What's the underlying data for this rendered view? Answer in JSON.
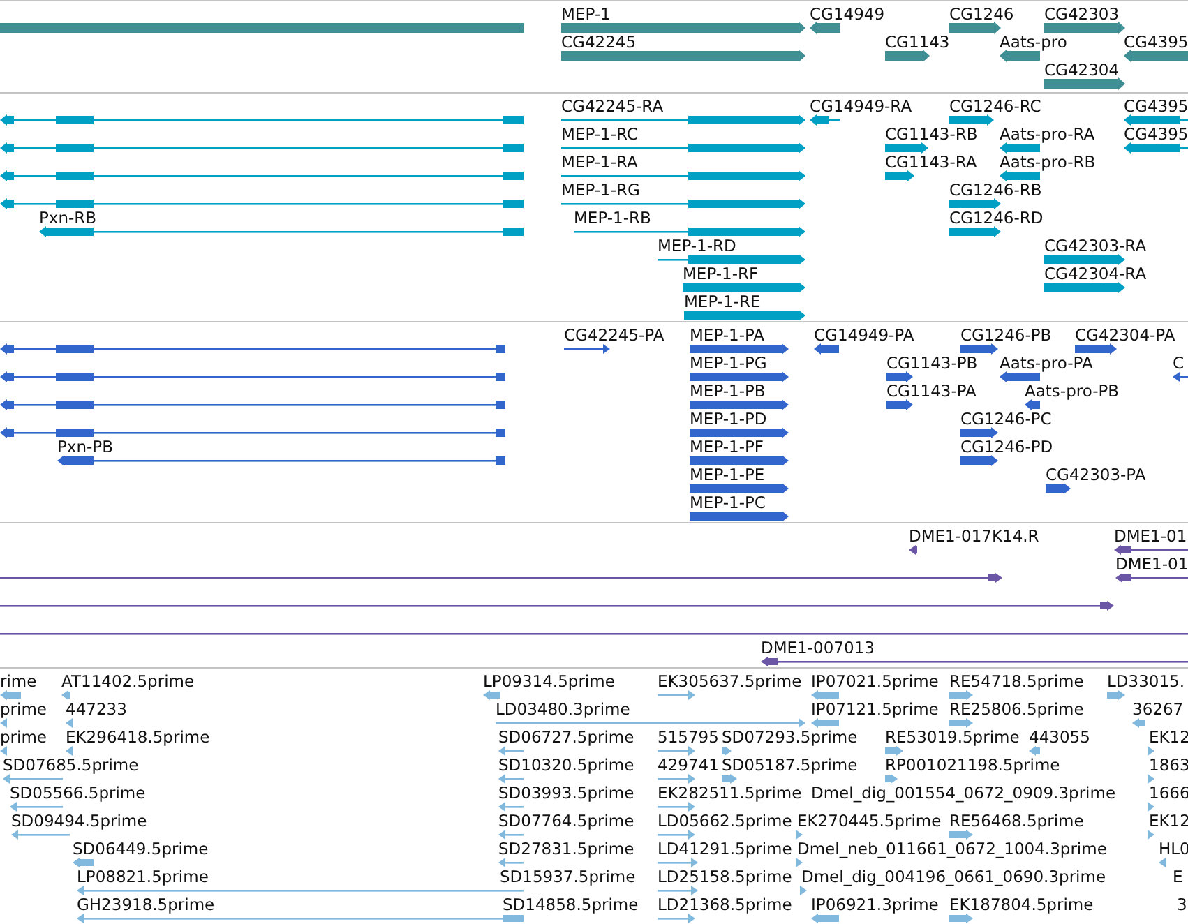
{
  "tracks": [
    {
      "kind": "gene",
      "features": [
        {
          "pointed": false
        },
        {
          "label": "MEP-1",
          "reverse": false
        },
        {
          "label": "CG14949",
          "reverse": true
        },
        {
          "label": "CG1246",
          "reverse": false
        },
        {
          "label": "CG42303",
          "reverse": false
        },
        {
          "label": "CG42245",
          "reverse": false
        },
        {
          "label": "CG1143",
          "reverse": false
        },
        {
          "label": "Aats-pro",
          "reverse": true
        },
        {
          "label": "CG4395",
          "reverse": true
        },
        {
          "label": "CG42304",
          "reverse": false
        }
      ]
    },
    {
      "kind": "transcript",
      "features": [
        {
          "reverse": true
        },
        {
          "label": "CG42245-RA",
          "reverse": false
        },
        {
          "label": "CG14949-RA",
          "reverse": true
        },
        {
          "label": "CG1246-RC",
          "reverse": false
        },
        {
          "label": "CG4395",
          "reverse": true
        },
        {
          "reverse": true
        },
        {
          "label": "MEP-1-RC",
          "reverse": false
        },
        {
          "label": "CG1143-RB",
          "reverse": false
        },
        {
          "label": "Aats-pro-RA",
          "reverse": true
        },
        {
          "label": "CG4395",
          "reverse": true
        },
        {
          "reverse": true
        },
        {
          "label": "MEP-1-RA",
          "reverse": false
        },
        {
          "label": "CG1143-RA",
          "reverse": false
        },
        {
          "label": "Aats-pro-RB",
          "reverse": true
        },
        {
          "reverse": true
        },
        {
          "label": "MEP-1-RG",
          "reverse": false
        },
        {
          "label": "CG1246-RB",
          "reverse": false
        },
        {
          "label": "Pxn-RB",
          "reverse": true
        },
        {
          "label": "MEP-1-RB",
          "reverse": false
        },
        {
          "label": "CG1246-RD",
          "reverse": false
        },
        {
          "label": "MEP-1-RD",
          "reverse": false
        },
        {
          "label": "CG42303-RA",
          "reverse": false
        },
        {
          "label": "MEP-1-RF",
          "reverse": false
        },
        {
          "label": "CG42304-RA",
          "reverse": false
        },
        {
          "label": "MEP-1-RE",
          "reverse": false
        }
      ]
    },
    {
      "kind": "protein",
      "features": [
        {
          "reverse": true
        },
        {
          "label": "CG42245-PA",
          "reverse": false
        },
        {
          "label": "MEP-1-PA",
          "reverse": false
        },
        {
          "label": "CG14949-PA",
          "reverse": true
        },
        {
          "label": "CG1246-PB",
          "reverse": false
        },
        {
          "label": "CG42304-PA",
          "reverse": false
        },
        {
          "reverse": true
        },
        {
          "label": "MEP-1-PG",
          "reverse": false
        },
        {
          "label": "CG1143-PB",
          "reverse": false
        },
        {
          "label": "Aats-pro-PA",
          "reverse": true
        },
        {
          "label": "C",
          "reverse": true
        },
        {
          "reverse": true
        },
        {
          "label": "MEP-1-PB",
          "reverse": false
        },
        {
          "label": "CG1143-PA",
          "reverse": false
        },
        {
          "label": "Aats-pro-PB",
          "reverse": true
        },
        {
          "reverse": true
        },
        {
          "label": "MEP-1-PD",
          "reverse": false
        },
        {
          "label": "CG1246-PC",
          "reverse": false
        },
        {
          "label": "Pxn-PB",
          "reverse": true
        },
        {
          "label": "MEP-1-PF",
          "reverse": false
        },
        {
          "label": "CG1246-PD",
          "reverse": false
        },
        {
          "label": "MEP-1-PE",
          "reverse": false
        },
        {
          "label": "CG42303-PA",
          "reverse": false
        },
        {
          "label": "MEP-1-PC",
          "reverse": false
        }
      ]
    },
    {
      "kind": "clone",
      "features": [
        {
          "label": "DME1-017K14.R",
          "reverse": true
        },
        {
          "label": "DME1-01",
          "reverse": true
        },
        {
          "reverse": false
        },
        {
          "label": "DME1-01",
          "reverse": true
        },
        {
          "reverse": false
        },
        {
          "pointed": false
        },
        {
          "label": "DME1-007013",
          "reverse": true
        }
      ]
    },
    {
      "kind": "est",
      "features": [
        {
          "label": "rime",
          "reverse": true
        },
        {
          "label": "AT11402.5prime",
          "reverse": true
        },
        {
          "label": "LP09314.5prime",
          "reverse": true
        },
        {
          "label": "EK305637.5prime",
          "reverse": false
        },
        {
          "label": "IP07021.5prime",
          "reverse": true
        },
        {
          "label": "RE54718.5prime",
          "reverse": false
        },
        {
          "label": "LD33015.",
          "reverse": false
        },
        {
          "label": "prime",
          "reverse": true
        },
        {
          "label": "447233",
          "reverse": true
        },
        {
          "label": "LD03480.3prime",
          "reverse": false
        },
        {
          "label": "IP07121.5prime",
          "reverse": true
        },
        {
          "label": "RE25806.5prime",
          "reverse": false
        },
        {
          "label": "36267",
          "reverse": true
        },
        {
          "label": "prime",
          "reverse": true
        },
        {
          "label": "EK296418.5prime",
          "reverse": true
        },
        {
          "label": "SD06727.5prime",
          "reverse": true
        },
        {
          "label": "515795",
          "reverse": false
        },
        {
          "label": "SD07293.5prime",
          "reverse": false
        },
        {
          "label": "RE53019.5prime",
          "reverse": false
        },
        {
          "label": "443055",
          "reverse": true
        },
        {
          "label": "EK12",
          "reverse": false
        },
        {
          "label": "SD07685.5prime",
          "reverse": true
        },
        {
          "label": "SD10320.5prime",
          "reverse": true
        },
        {
          "label": "429741",
          "reverse": false
        },
        {
          "label": "SD05187.5prime",
          "reverse": false
        },
        {
          "label": "RP001021198.5prime",
          "reverse": false
        },
        {
          "label": "1863",
          "reverse": false
        },
        {
          "label": "SD05566.5prime",
          "reverse": true
        },
        {
          "label": "SD03993.5prime",
          "reverse": true
        },
        {
          "label": "EK282511.5prime",
          "reverse": false
        },
        {
          "label": "Dmel_dig_001554_0672_0909.3prime"
        },
        {
          "label": "1666",
          "reverse": false
        },
        {
          "label": "SD09494.5prime",
          "reverse": true
        },
        {
          "label": "SD07764.5prime",
          "reverse": true
        },
        {
          "label": "LD05662.5prime",
          "reverse": false
        },
        {
          "label": "EK270445.5prime",
          "reverse": false
        },
        {
          "label": "RE56468.5prime",
          "reverse": false
        },
        {
          "label": "EK12",
          "reverse": false
        },
        {
          "label": "SD06449.5prime",
          "reverse": true
        },
        {
          "label": "SD27831.5prime",
          "reverse": true
        },
        {
          "label": "LD41291.5prime",
          "reverse": false
        },
        {
          "label": "Dmel_neb_011661_0672_1004.3prime",
          "reverse": false
        },
        {
          "label": "HL0",
          "reverse": true
        },
        {
          "label": "LP08821.5prime",
          "reverse": true
        },
        {
          "label": "SD15937.5prime"
        },
        {
          "label": "LD25158.5prime",
          "reverse": false
        },
        {
          "label": "Dmel_dig_004196_0661_0690.3prime",
          "reverse": false
        },
        {
          "label": "E"
        },
        {
          "label": "GH23918.5prime",
          "reverse": true
        },
        {
          "label": "SD14858.5prime"
        },
        {
          "label": "LD21368.5prime",
          "reverse": false
        },
        {
          "label": "IP06921.3prime",
          "reverse": true
        },
        {
          "label": "EK187804.5prime",
          "reverse": false
        },
        {
          "label": "3"
        }
      ]
    }
  ]
}
